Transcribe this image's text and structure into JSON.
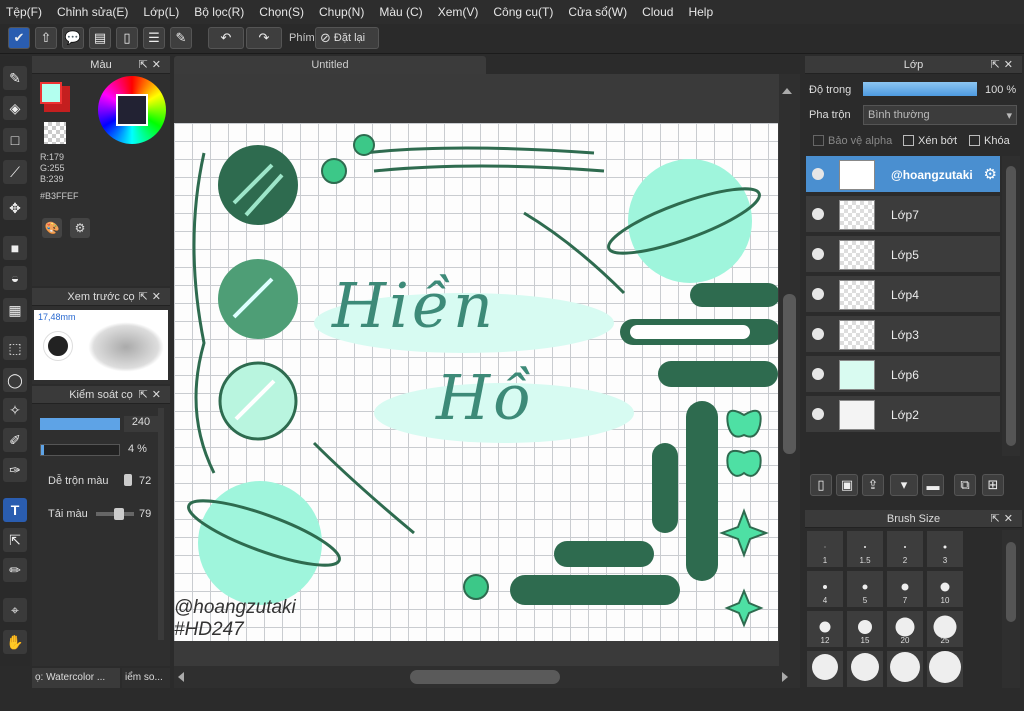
{
  "menu": [
    "Tệp(F)",
    "Chỉnh sửa(E)",
    "Lớp(L)",
    "Bộ lọc(R)",
    "Chọn(S)",
    "Chụp(N)",
    "Màu (C)",
    "Xem(V)",
    "Công cụ(T)",
    "Cửa sổ(W)",
    "Cloud",
    "Help"
  ],
  "toolbar": {
    "phim_label": "Phím",
    "reset_label": "Đặt lại"
  },
  "color_panel": {
    "title": "Màu",
    "r": "R:179",
    "g": "G:255",
    "b": "B:239",
    "hex": "#B3FFEF",
    "fg_color": "#b3ffef",
    "bg_color": "#c41f1f"
  },
  "brush_preview": {
    "title": "Xem trước cọ",
    "size": "17,48mm"
  },
  "brush_control": {
    "title": "Kiểm soát cọ",
    "size_value": "240",
    "opacity_value": "4 %",
    "blend_label": "Dễ trộn màu",
    "blend_value": "72",
    "load_label": "Tải màu",
    "load_value": "79"
  },
  "left_tabs": [
    "ọ: Watercolor ...",
    "iểm so..."
  ],
  "document": {
    "tab_title": "Untitled",
    "title_line1": "Hiền",
    "title_line2": "Hồ",
    "watermark1": "@hoangzutaki",
    "watermark2": "#HD247"
  },
  "layers_panel": {
    "title": "Lớp",
    "opacity_label": "Độ trong",
    "opacity_value": "100 %",
    "blend_label": "Pha trộn",
    "blend_value": "Bình thường",
    "protect_alpha": "Bảo vệ alpha",
    "clipping": "Xén bớt",
    "lock": "Khóa",
    "layers": [
      {
        "name": "@hoangzutaki",
        "selected": true
      },
      {
        "name": "Lớp7",
        "selected": false
      },
      {
        "name": "Lớp5",
        "selected": false
      },
      {
        "name": "Lớp4",
        "selected": false
      },
      {
        "name": "Lớp3",
        "selected": false
      },
      {
        "name": "Lớp6",
        "selected": false
      },
      {
        "name": "Lớp2",
        "selected": false
      }
    ]
  },
  "brush_size_panel": {
    "title": "Brush Size",
    "sizes": [
      "1",
      "1.5",
      "2",
      "3",
      "4",
      "5",
      "7",
      "10",
      "12",
      "15",
      "20",
      "25"
    ]
  },
  "colors": {
    "accent": "#4a8fd0",
    "mint": "#9ff5dc",
    "dark_green": "#2e6b4f"
  }
}
